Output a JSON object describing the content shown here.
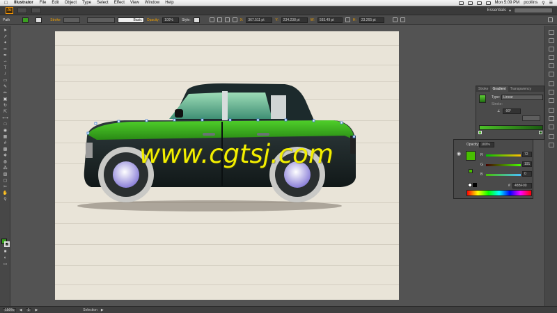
{
  "menubar": {
    "app_name": "Illustrator",
    "items": [
      "File",
      "Edit",
      "Object",
      "Type",
      "Select",
      "Effect",
      "View",
      "Window",
      "Help"
    ],
    "clock": "Mon 5:09 PM",
    "user": "pcollins"
  },
  "appbar": {
    "logo": "Ai",
    "workspace": "Essentials"
  },
  "control": {
    "selection_label": "Path",
    "stroke_label": "Stroke",
    "stroke_style": "Basic",
    "opacity_label": "Opacity:",
    "opacity_value": "100%",
    "style_label": "Style:",
    "x_label": "X:",
    "x_value": "367.511 pt",
    "y_label": "Y:",
    "y_value": "234.238 pt",
    "w_label": "W:",
    "w_value": "593.49 pt",
    "h_label": "H:",
    "h_value": "23.265 pt",
    "fill_color": "#3aa020"
  },
  "gradient_panel": {
    "tabs": [
      "Stroke",
      "Gradient",
      "Transparency"
    ],
    "active_tab": "Gradient",
    "type_label": "Type:",
    "type_value": "Linear",
    "stroke_label": "Stroke:",
    "angle_value": "-90°"
  },
  "color_panel": {
    "opacity_label": "Opacity:",
    "opacity_value": "100%",
    "r_label": "R",
    "r_value": "72",
    "g_label": "G",
    "g_value": "191",
    "b_label": "B",
    "b_value": "0",
    "hex_value": "48BF00",
    "swatch_color": "#48bf00"
  },
  "status": {
    "zoom": "150%",
    "artboard": "1",
    "tool": "Selection"
  },
  "watermark": "www.cgtsj.com"
}
